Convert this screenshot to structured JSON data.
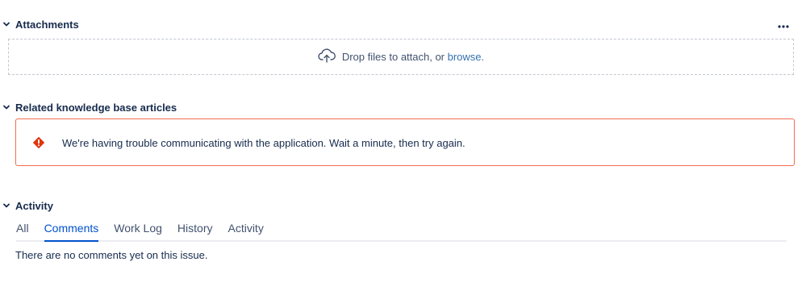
{
  "attachments": {
    "title": "Attachments",
    "dropzone_text": "Drop files to attach, or ",
    "browse_label": "browse."
  },
  "kb": {
    "title": "Related knowledge base articles",
    "error_message": "We're having trouble communicating with the application. Wait a minute, then try again."
  },
  "activity": {
    "title": "Activity",
    "tabs": [
      {
        "label": "All"
      },
      {
        "label": "Comments"
      },
      {
        "label": "Work Log"
      },
      {
        "label": "History"
      },
      {
        "label": "Activity"
      }
    ],
    "active_tab": "Comments",
    "empty_message": "There are no comments yet on this issue."
  },
  "colors": {
    "link": "#3572b0",
    "error_border": "#f26d4f",
    "active_tab": "#0052cc"
  },
  "icons": {
    "section_toggle": "chevron-down-icon",
    "more": "more-horizontal-icon",
    "upload": "cloud-upload-icon",
    "error": "error-icon"
  }
}
